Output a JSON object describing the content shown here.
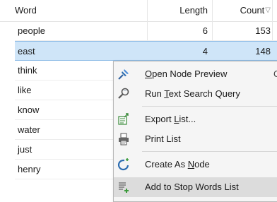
{
  "columns": {
    "word": "Word",
    "length": "Length",
    "count": "Count",
    "sort_indicator": "▽"
  },
  "rows": [
    {
      "word": "people",
      "length": "6",
      "count": "153"
    },
    {
      "word": "east",
      "length": "4",
      "count": "148"
    },
    {
      "word": "think",
      "length": "",
      "count": ""
    },
    {
      "word": "like",
      "length": "",
      "count": ""
    },
    {
      "word": "know",
      "length": "",
      "count": ""
    },
    {
      "word": "water",
      "length": "",
      "count": ""
    },
    {
      "word": "just",
      "length": "",
      "count": ""
    },
    {
      "word": "henry",
      "length": "",
      "count": ""
    }
  ],
  "selected_row_index": 1,
  "context_menu": {
    "items": [
      {
        "pre": "",
        "ul": "O",
        "post": "pen Node Preview",
        "shortcut": "C",
        "icon": "pin-icon"
      },
      {
        "pre": "Run ",
        "ul": "T",
        "post": "ext Search Query",
        "shortcut": "",
        "icon": "magnifier-icon"
      },
      {
        "pre": "Export ",
        "ul": "L",
        "post": "ist...",
        "shortcut": "",
        "icon": "export-icon"
      },
      {
        "pre": "Print List",
        "ul": "",
        "post": "",
        "shortcut": "",
        "icon": "printer-icon"
      },
      {
        "pre": "Create As ",
        "ul": "N",
        "post": "ode",
        "shortcut": "",
        "icon": "create-node-icon"
      },
      {
        "pre": "Add to Stop Words List",
        "ul": "",
        "post": "",
        "shortcut": "",
        "icon": "stop-words-icon"
      }
    ],
    "highlighted_index": 5
  },
  "colors": {
    "selection": "#cfe5f8",
    "selection_border": "#8dbbe6",
    "menu_bg": "#f5f5f5",
    "menu_highlight": "#dcdcdc",
    "icon_blue": "#2b6cb0"
  }
}
